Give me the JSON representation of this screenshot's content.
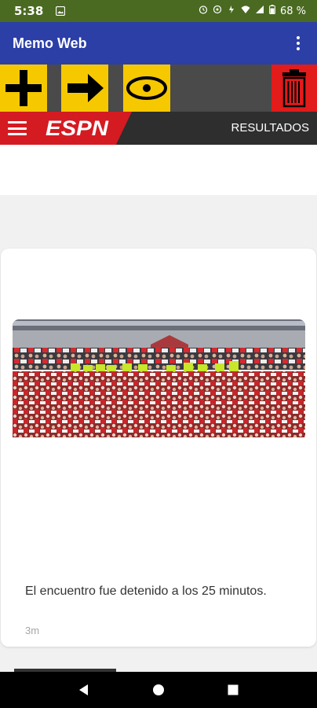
{
  "status_bar": {
    "time": "5:38",
    "battery": "68 %",
    "icons": [
      "image-notification-icon",
      "alarm-icon",
      "sync-icon",
      "data-saver-icon",
      "wifi-icon",
      "signal-icon",
      "battery-icon"
    ]
  },
  "app_bar": {
    "title": "Memo Web",
    "menu_icon": "more-vert-icon"
  },
  "toolbar": {
    "buttons": [
      {
        "icon": "plus-icon",
        "color": "#f6c800"
      },
      {
        "icon": "arrow-right-icon",
        "color": "#f6c800"
      },
      {
        "icon": "eye-icon",
        "color": "#f6c800"
      },
      {
        "icon": "trash-icon",
        "color": "#e21b1b"
      }
    ]
  },
  "espn": {
    "logo_text": "ESPN",
    "results_label": "RESULTADOS",
    "brand_red": "#d41b22"
  },
  "article": {
    "headline": "El encuentro fue detenido a los 25 minutos.",
    "time_ago": "3m"
  },
  "nav_bar": {
    "buttons": [
      "back-icon",
      "home-icon",
      "recents-icon"
    ]
  },
  "colors": {
    "status_bar": "#4a6a22",
    "app_bar": "#2b3fa6",
    "toolbar_bg": "#4a4a4a",
    "espn_bar": "#2e2e2e"
  }
}
